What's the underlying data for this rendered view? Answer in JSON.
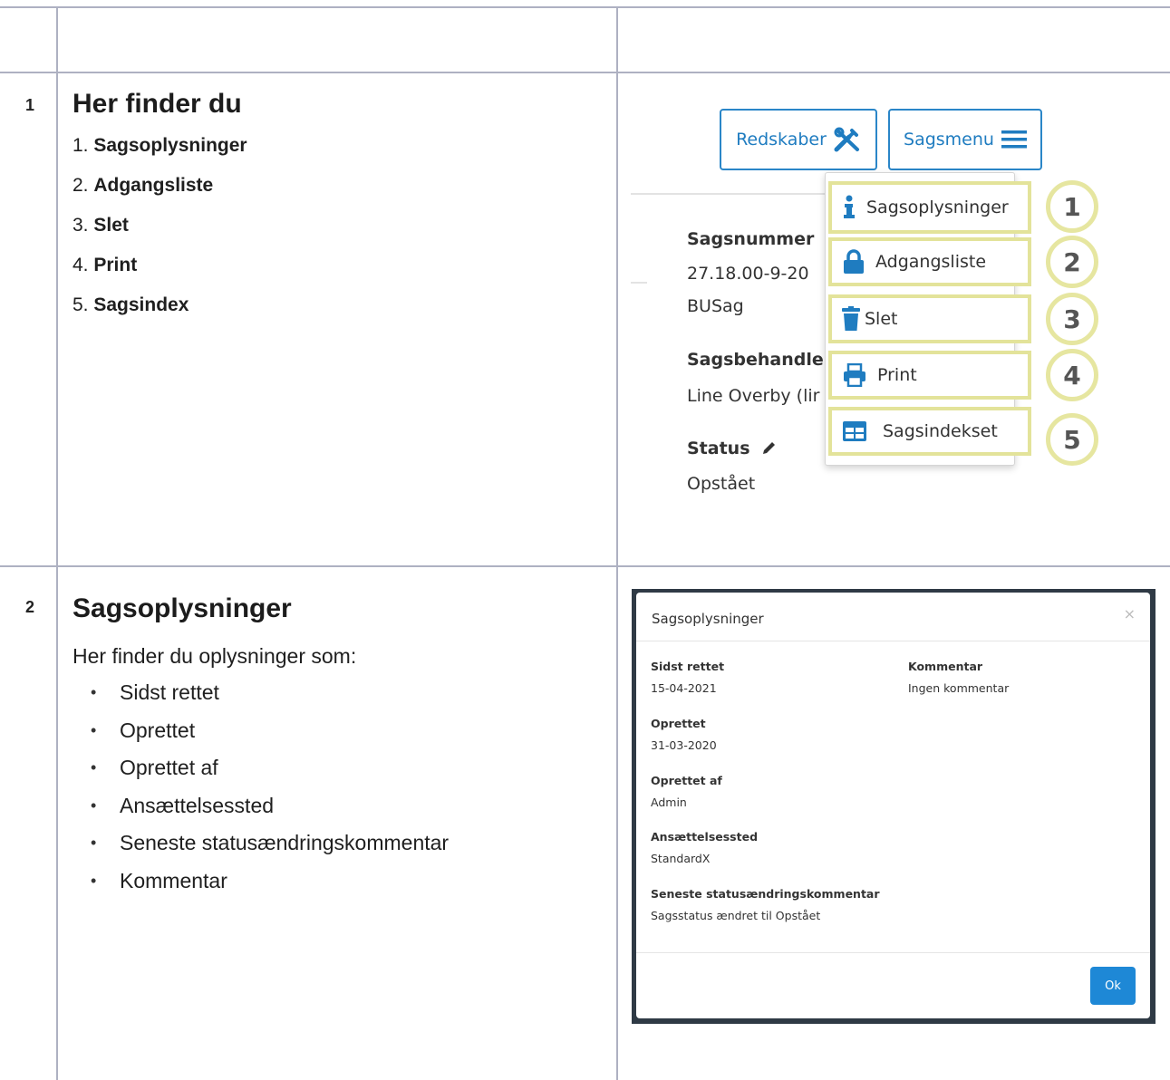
{
  "rows": [
    {
      "number": "1",
      "heading": "Her finder du",
      "list": [
        {
          "num": "1. ",
          "label": "Sagsoplysninger"
        },
        {
          "num": "2. ",
          "label": "Adgangsliste"
        },
        {
          "num": "3. ",
          "label": "Slet"
        },
        {
          "num": "4. ",
          "label": "Print"
        },
        {
          "num": "5. ",
          "label": "Sagsindex"
        }
      ]
    },
    {
      "number": "2",
      "heading": "Sagsoplysninger",
      "intro": "Her finder du oplysninger som:",
      "bullets": [
        "Sidst rettet",
        "Oprettet",
        "Oprettet af",
        "Ansættelsessted",
        "Seneste statusændringskommentar",
        "Kommentar"
      ]
    }
  ],
  "shot1": {
    "tools_button": "Redskaber",
    "menu_button": "Sagsmenu",
    "fields": [
      {
        "label": "Sagsnummer",
        "values": [
          "27.18.00-9-20",
          "BUSag"
        ]
      },
      {
        "label": "Sagsbehandler",
        "values": [
          "Line Overby (lir"
        ]
      },
      {
        "label": "Status",
        "values": [
          "Opstået"
        ]
      }
    ],
    "menu_items": [
      {
        "icon": "info-icon",
        "label": "Sagsoplysninger",
        "marker": "1"
      },
      {
        "icon": "lock-icon",
        "label": "Adgangsliste",
        "marker": "2"
      },
      {
        "icon": "trash-icon",
        "label": "Slet",
        "marker": "3"
      },
      {
        "icon": "printer-icon",
        "label": "Print",
        "marker": "4"
      },
      {
        "icon": "table-icon",
        "label": "Sagsindekset",
        "marker": "5"
      }
    ],
    "colors": {
      "accent": "#1f7cc0",
      "highlight": "#e3e39a"
    }
  },
  "shot2": {
    "title": "Sagsoplysninger",
    "close": "×",
    "left_fields": [
      {
        "label": "Sidst rettet",
        "value": "15-04-2021"
      },
      {
        "label": "Oprettet",
        "value": "31-03-2020"
      },
      {
        "label": "Oprettet af",
        "value": "Admin"
      },
      {
        "label": "Ansættelsessted",
        "value": "StandardX"
      },
      {
        "label": "Seneste statusændringskommentar",
        "value": "Sagsstatus ændret til Opstået"
      }
    ],
    "right_fields": [
      {
        "label": "Kommentar",
        "value": "Ingen kommentar"
      }
    ],
    "ok_label": "Ok"
  }
}
